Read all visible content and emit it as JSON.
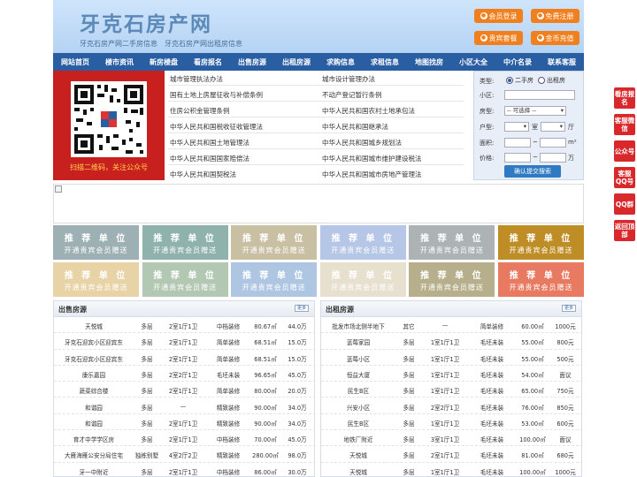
{
  "header": {
    "logo": "牙克石房产网",
    "sublinks": [
      "牙克石房产网二手房信息",
      "牙克石房产网出租房信息"
    ],
    "buttons": [
      "会员登录",
      "免费注册",
      "贵宾套餐",
      "金币充值"
    ]
  },
  "nav": [
    "网站首页",
    "楼市资讯",
    "新房楼盘",
    "看房报名",
    "出售房源",
    "出租房源",
    "求购信息",
    "求租信息",
    "地图找房",
    "小区大全",
    "中介名录",
    "联系客服"
  ],
  "qr": {
    "caption": "扫描二维码，关注公众号"
  },
  "news": {
    "left": [
      "城市管理执法办法",
      "国有土地上房屋征收与补偿条例",
      "住房公积金管理条例",
      "中华人民共和国税收征收管理法",
      "中华人民共和国土地管理法",
      "中华人民共和国国家赔偿法",
      "中华人民共和国契税法"
    ],
    "right": [
      "城市设计管理办法",
      "不动产登记暂行条例",
      "中华人民共和国农村土地承包法",
      "中华人民共和国继承法",
      "中华人民共和国城乡规划法",
      "中华人民共和国城市维护建设税法",
      "中华人民共和国城市房地产管理法"
    ]
  },
  "search": {
    "type_label": "类型:",
    "radio1": "二手房",
    "radio2": "出租房",
    "community_label": "小区:",
    "house_label": "房型:",
    "house_select": "-- 可选择 --",
    "layout_label": "户型:",
    "room": "室",
    "hall": "厅",
    "area_label": "面积:",
    "area_unit": "m²",
    "price_label": "价格:",
    "price_unit": "万",
    "tilde": "~",
    "submit": "确认提交搜索"
  },
  "ads": {
    "title": "推 荐 单 位",
    "sub": "开通贵宾会员赠送",
    "colors": [
      "#9db0b4",
      "#8fb2ad",
      "#c9c0a4",
      "#b6c6e6",
      "#adb3b5",
      "#bf8d26",
      "#e8d3a6",
      "#b2c8b2",
      "#afc6e3",
      "#e8e0cf",
      "#b7ae8c",
      "#e77a61"
    ]
  },
  "sale": {
    "title": "出售房源",
    "more": "更多",
    "rows": [
      [
        "天悦城",
        "多层",
        "2室1厅1卫",
        "中档装修",
        "80.67㎡",
        "44.0万"
      ],
      [
        "牙克石迎宾小区迎宾东",
        "多层",
        "2室1厅1卫",
        "简单装修",
        "68.51㎡",
        "15.0万"
      ],
      [
        "牙克石迎宾小区迎宾东",
        "多层",
        "2室1厅1卫",
        "简单装修",
        "68.51㎡",
        "15.0万"
      ],
      [
        "康乐嘉园",
        "多层",
        "2室2厅1卫",
        "毛坯未装",
        "96.65㎡",
        "45.0万"
      ],
      [
        "蔬菜综合楼",
        "多层",
        "2室1厅1卫",
        "简单装修",
        "80.00㎡",
        "20.0万"
      ],
      [
        "和谐园",
        "多层",
        "—",
        "精致装修",
        "90.00㎡",
        "34.0万"
      ],
      [
        "和谐园",
        "多层",
        "2室1厅1卫",
        "精致装修",
        "90.00㎡",
        "34.0万"
      ],
      [
        "育才中学学区房",
        "多层",
        "2室1厅1卫",
        "中档装修",
        "70.00㎡",
        "45.0万"
      ],
      [
        "大雁海雁公安分局住宅",
        "独栋别墅",
        "4室2厅2卫",
        "精致装修",
        "280.00㎡",
        "98.0万"
      ],
      [
        "牙一中附近",
        "多层",
        "2室1厅1卫",
        "中档装修",
        "86.00㎡",
        "30.0万"
      ]
    ]
  },
  "rent": {
    "title": "出租房源",
    "more": "更多",
    "rows": [
      [
        "批发市场北侧半地下",
        "其它",
        "—",
        "简单装修",
        "60.00㎡",
        "1000元"
      ],
      [
        "蓝莓家园",
        "多层",
        "1室1厅1卫",
        "毛坯未装",
        "55.00㎡",
        "800元"
      ],
      [
        "蓝莓小区",
        "多层",
        "1室1厅1卫",
        "毛坯未装",
        "55.00㎡",
        "500元"
      ],
      [
        "恒益大厦",
        "多层",
        "1室1厅1卫",
        "毛坯未装",
        "54.00㎡",
        "面议"
      ],
      [
        "民生B区",
        "多层",
        "1室1厅1卫",
        "毛坯未装",
        "65.00㎡",
        "750元"
      ],
      [
        "兴安小区",
        "多层",
        "2室2厅1卫",
        "毛坯未装",
        "76.00㎡",
        "850元"
      ],
      [
        "民生B区",
        "多层",
        "1室1厅1卫",
        "毛坯未装",
        "53.00㎡",
        "600元"
      ],
      [
        "地铁厂附近",
        "多层",
        "3室1厅1卫",
        "毛坯未装",
        "100.00㎡",
        "面议"
      ],
      [
        "天悦城",
        "多层",
        "2室1厅1卫",
        "毛坯未装",
        "81.00㎡",
        "680元"
      ],
      [
        "天悦城",
        "多层",
        "1室1厅1卫",
        "毛坯未装",
        "100.00㎡",
        "1000元"
      ]
    ]
  },
  "sidebar": [
    "看房报名",
    "客服微信",
    "公众号",
    "客服QQ号",
    "QQ群",
    "返回顶部"
  ]
}
